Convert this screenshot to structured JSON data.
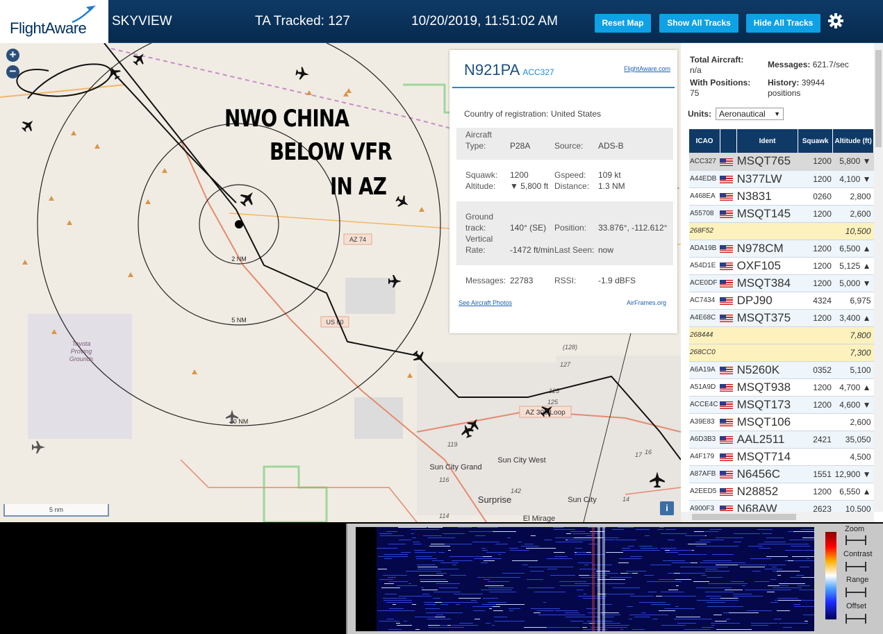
{
  "header": {
    "logo_text": "FlightAware",
    "title": "SKYVIEW",
    "tracked": "TA Tracked: 127",
    "datetime": "10/20/2019, 11:51:02 AM",
    "buttons": {
      "reset": "Reset Map",
      "show_tracks": "Show All Tracks",
      "hide_tracks": "Hide All Tracks"
    },
    "settings_icon": "gear-icon"
  },
  "map": {
    "zoom_in": "+",
    "zoom_out": "−",
    "scale_label": "5 nm",
    "overlay_lines": [
      "NWO CHINA",
      "BELOW VFR",
      "IN AZ"
    ],
    "ring_labels": [
      "2 NM",
      "5 NM",
      "10 NM"
    ],
    "road_labels": [
      "AZ 74",
      "US 60",
      "AZ 303 Loop"
    ],
    "place_labels": [
      "Toyota",
      "Proving",
      "Grounds",
      "Sun City Grand",
      "Sun City West",
      "Surprise",
      "Sun City",
      "El Mirage"
    ],
    "route_numbers": [
      "(128)",
      "127",
      "125",
      "125",
      "119",
      "116",
      "114",
      "142",
      "17",
      "16",
      "14"
    ],
    "info_button": "i"
  },
  "popup": {
    "registration": "N921PA",
    "icao": "ACC327",
    "flightaware_link": "FlightAware.com",
    "country_label": "Country of registration:",
    "country_value": "United States",
    "aircraft_type_label": "Aircraft Type:",
    "aircraft_type_value": "P28A",
    "source_label": "Source:",
    "source_value": "ADS-B",
    "squawk_label": "Squawk:",
    "squawk_value": "1200",
    "gspeed_label": "Gspeed:",
    "gspeed_value": "109 kt",
    "altitude_label": "Altitude:",
    "altitude_value": "▼ 5,800 ft",
    "distance_label": "Distance:",
    "distance_value": "1.3 NM",
    "ground_track_label": "Ground track:",
    "ground_track_value": "140° (SE)",
    "position_label": "Position:",
    "position_value": "33.876°, -112.612°",
    "vertical_rate_label": "Vertical Rate:",
    "vertical_rate_value": "-1472 ft/min",
    "last_seen_label": "Last Seen:",
    "last_seen_value": "now",
    "messages_label": "Messages:",
    "messages_value": "22783",
    "rssi_label": "RSSI:",
    "rssi_value": "-1.9 dBFS",
    "photos_link": "See Aircraft Photos",
    "airframes_link": "AirFrames.org"
  },
  "sidebar": {
    "total_aircraft_label": "Total Aircraft:",
    "total_aircraft_value": "n/a",
    "with_positions_label": "With Positions:",
    "with_positions_value": "75",
    "messages_label": "Messages:",
    "messages_value": "621.7/sec",
    "history_label": "History:",
    "history_value": "39944",
    "history_unit": "positions",
    "units_label": "Units:",
    "units_value": "Aeronautical",
    "columns": [
      "ICAO",
      "Ident",
      "Squawk",
      "Altitude (ft)"
    ],
    "rows": [
      {
        "icao": "ACC327",
        "flag": true,
        "ident": "MSQT765",
        "squawk": "1200",
        "alt": "5,800 ▼",
        "kind": "sel"
      },
      {
        "icao": "A44EDB",
        "flag": true,
        "ident": "N377LW",
        "squawk": "1200",
        "alt": "4,100 ▼",
        "kind": "odd"
      },
      {
        "icao": "A468EA",
        "flag": true,
        "ident": "N3831",
        "squawk": "0260",
        "alt": "2,800",
        "kind": "even"
      },
      {
        "icao": "A55708",
        "flag": true,
        "ident": "MSQT145",
        "squawk": "1200",
        "alt": "2,600",
        "kind": "odd"
      },
      {
        "icao": "268F52",
        "flag": false,
        "ident": "",
        "squawk": "",
        "alt": "10,500",
        "kind": "nopos"
      },
      {
        "icao": "ADA19B",
        "flag": true,
        "ident": "N978CM",
        "squawk": "1200",
        "alt": "6,500 ▲",
        "kind": "odd"
      },
      {
        "icao": "A54D1E",
        "flag": true,
        "ident": "OXF105",
        "squawk": "1200",
        "alt": "5,125 ▲",
        "kind": "even"
      },
      {
        "icao": "ACE0DF",
        "flag": true,
        "ident": "MSQT384",
        "squawk": "1200",
        "alt": "5,000 ▼",
        "kind": "odd"
      },
      {
        "icao": "AC7434",
        "flag": true,
        "ident": "DPJ90",
        "squawk": "4324",
        "alt": "6,975",
        "kind": "even"
      },
      {
        "icao": "A4E68C",
        "flag": true,
        "ident": "MSQT375",
        "squawk": "1200",
        "alt": "3,400 ▲",
        "kind": "odd"
      },
      {
        "icao": "268444",
        "flag": false,
        "ident": "",
        "squawk": "",
        "alt": "7,800",
        "kind": "nopos"
      },
      {
        "icao": "268CC0",
        "flag": false,
        "ident": "",
        "squawk": "",
        "alt": "7,300",
        "kind": "nopos"
      },
      {
        "icao": "A6A19A",
        "flag": true,
        "ident": "N5260K",
        "squawk": "0352",
        "alt": "5,100",
        "kind": "odd"
      },
      {
        "icao": "A51A9D",
        "flag": true,
        "ident": "MSQT938",
        "squawk": "1200",
        "alt": "4,700 ▲",
        "kind": "even"
      },
      {
        "icao": "ACCE4C",
        "flag": true,
        "ident": "MSQT173",
        "squawk": "1200",
        "alt": "4,600 ▼",
        "kind": "odd"
      },
      {
        "icao": "A39E83",
        "flag": true,
        "ident": "MSQT106",
        "squawk": "",
        "alt": "2,600",
        "kind": "even"
      },
      {
        "icao": "A6D3B3",
        "flag": true,
        "ident": "AAL2511",
        "squawk": "2421",
        "alt": "35,050",
        "kind": "odd"
      },
      {
        "icao": "A4F179",
        "flag": true,
        "ident": "MSQT714",
        "squawk": "",
        "alt": "4,500",
        "kind": "even"
      },
      {
        "icao": "A87AFB",
        "flag": true,
        "ident": "N6456C",
        "squawk": "1551",
        "alt": "12,900 ▼",
        "kind": "odd"
      },
      {
        "icao": "A2EED5",
        "flag": true,
        "ident": "N28852",
        "squawk": "1200",
        "alt": "6,550 ▲",
        "kind": "even"
      },
      {
        "icao": "A900F3",
        "flag": true,
        "ident": "N68AW",
        "squawk": "2623",
        "alt": "10,500",
        "kind": "odd"
      }
    ]
  },
  "waterfall": {
    "controls": [
      "Zoom",
      "Contrast",
      "Range",
      "Offset"
    ]
  }
}
